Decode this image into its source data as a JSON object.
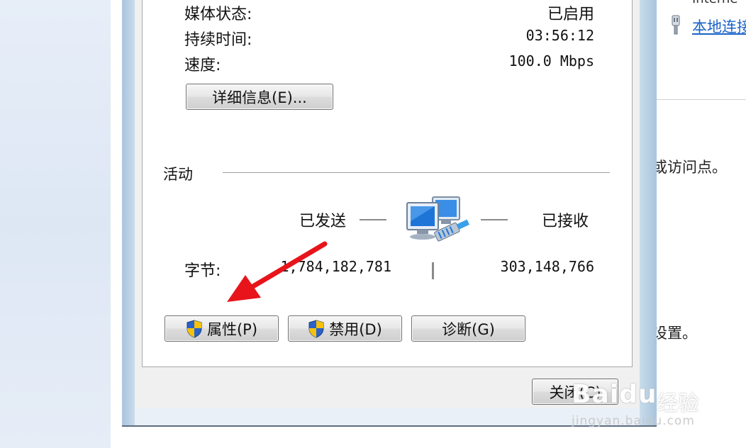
{
  "right_panel": {
    "top_text": "Interne",
    "link": "本地连接",
    "text_1": "或访问点。",
    "text_2": "设置。"
  },
  "connection": {
    "media_state_label": "媒体状态:",
    "media_state_value": "已启用",
    "duration_label": "持续时间:",
    "duration_value": "03:56:12",
    "speed_label": "速度:",
    "speed_value": "100.0 Mbps",
    "details_button": "详细信息(E)..."
  },
  "activity": {
    "title": "活动",
    "sent_label": "已发送",
    "received_label": "已接收",
    "bytes_label": "字节:",
    "bytes_sent": "1,784,182,781",
    "bytes_received": "303,148,766"
  },
  "buttons": {
    "properties": "属性(P)",
    "disable": "禁用(D)",
    "diagnose": "诊断(G)",
    "close": "关闭(C)"
  },
  "watermark": {
    "logo": "Baidu",
    "cn": "经验",
    "url": "jingyan.baidu.com"
  },
  "colors": {
    "arrow": "#e8141b",
    "link": "#1a63c8",
    "shield_blue": "#2a62c9",
    "shield_yellow": "#f4c20d"
  },
  "icons": [
    "network-connection-icon",
    "shield-icon",
    "annotation-arrow-icon",
    "network-plug-icon"
  ]
}
